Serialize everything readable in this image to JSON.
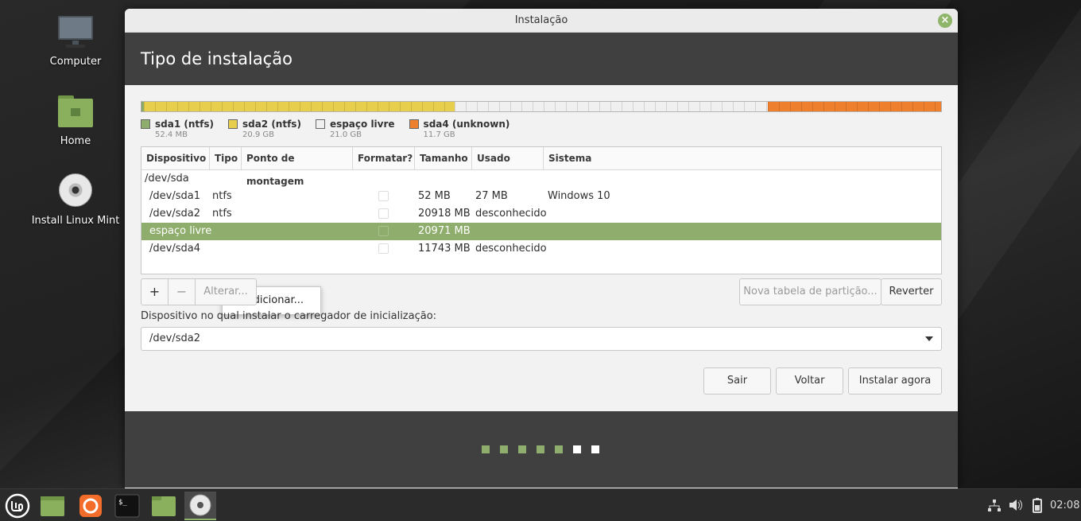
{
  "desktop": {
    "icons": [
      {
        "label": "Computer"
      },
      {
        "label": "Home"
      },
      {
        "label": "Install Linux Mint"
      }
    ]
  },
  "window": {
    "title": "Instalação",
    "header": "Tipo de instalação"
  },
  "partition_bar": {
    "segments": [
      {
        "name": "sda1 (ntfs)",
        "size": "52.4 MB",
        "color": "#8fad6c",
        "fraction": 0.0025
      },
      {
        "name": "sda2 (ntfs)",
        "size": "20.9 GB",
        "color": "#e7cf4d",
        "fraction": 0.3895
      },
      {
        "name": "espaço livre",
        "size": "21.0 GB",
        "color": "#f0f0f0",
        "fraction": 0.3915
      },
      {
        "name": "sda4 (unknown)",
        "size": "11.7 GB",
        "color": "#ee7f2d",
        "fraction": 0.2165
      }
    ]
  },
  "table": {
    "columns": [
      "Dispositivo",
      "Tipo",
      "Ponto de montagem",
      "Formatar?",
      "Tamanho",
      "Usado",
      "Sistema"
    ],
    "rows": [
      {
        "device": "/dev/sda",
        "type": "",
        "mount": "",
        "size": "",
        "used": "",
        "system": ""
      },
      {
        "device": "/dev/sda1",
        "type": "ntfs",
        "mount": "",
        "size": "52 MB",
        "used": "27 MB",
        "system": "Windows 10"
      },
      {
        "device": "/dev/sda2",
        "type": "ntfs",
        "mount": "",
        "size": "20918 MB",
        "used": "desconhecido",
        "system": ""
      },
      {
        "device": "espaço livre",
        "type": "",
        "mount": "",
        "size": "20971 MB",
        "used": "",
        "system": ""
      },
      {
        "device": "/dev/sda4",
        "type": "",
        "mount": "",
        "size": "11743 MB",
        "used": "desconhecido",
        "system": ""
      }
    ]
  },
  "context_menu": {
    "item": "Adicionar..."
  },
  "buttons": {
    "add": "+",
    "remove": "−",
    "change": "Alterar...",
    "new_table": "Nova tabela de partição...",
    "revert": "Reverter",
    "quit": "Sair",
    "back": "Voltar",
    "install": "Instalar agora"
  },
  "bootloader": {
    "label": "Dispositivo no qual instalar o carregador de inicialização:",
    "selected": "/dev/sda2"
  },
  "progress": {
    "total_steps": 7,
    "completed_steps": 5,
    "done_color": "#8fad6c",
    "pending_color": "#ffffff"
  },
  "taskbar": {
    "clock": "02:08",
    "apps": [
      "menu-icon",
      "files-icon",
      "firefox-icon",
      "terminal-icon",
      "folder-icon",
      "installer-disc-icon"
    ]
  }
}
